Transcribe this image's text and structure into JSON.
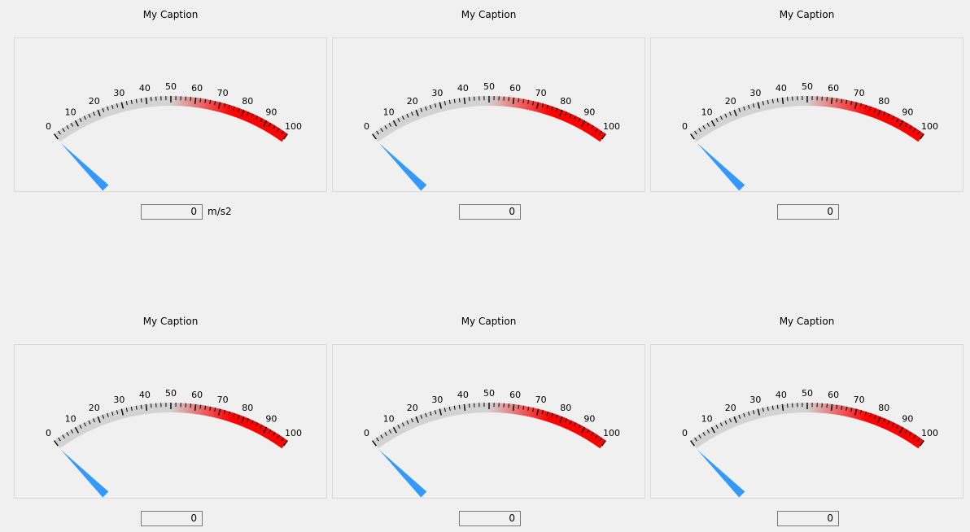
{
  "colors": {
    "arc_base": "#d3d3d3",
    "arc_alert": "#ff0000",
    "needle": "#3399ff"
  },
  "gauges": [
    {
      "caption": "My Caption",
      "value": "0",
      "unit": "m/s2",
      "min": 0,
      "max": 100,
      "alert_from": 50,
      "reading": 0
    },
    {
      "caption": "My Caption",
      "value": "0",
      "unit": "",
      "min": 0,
      "max": 100,
      "alert_from": 50,
      "reading": 0
    },
    {
      "caption": "My Caption",
      "value": "0",
      "unit": "",
      "min": 0,
      "max": 100,
      "alert_from": 50,
      "reading": 0
    },
    {
      "caption": "My Caption",
      "value": "0",
      "unit": "",
      "min": 0,
      "max": 100,
      "alert_from": 50,
      "reading": 0
    },
    {
      "caption": "My Caption",
      "value": "0",
      "unit": "",
      "min": 0,
      "max": 100,
      "alert_from": 50,
      "reading": 0
    },
    {
      "caption": "My Caption",
      "value": "0",
      "unit": "",
      "min": 0,
      "max": 100,
      "alert_from": 50,
      "reading": 0
    }
  ],
  "scale_labels": [
    "0",
    "10",
    "20",
    "30",
    "40",
    "50",
    "60",
    "70",
    "80",
    "90",
    "100"
  ]
}
